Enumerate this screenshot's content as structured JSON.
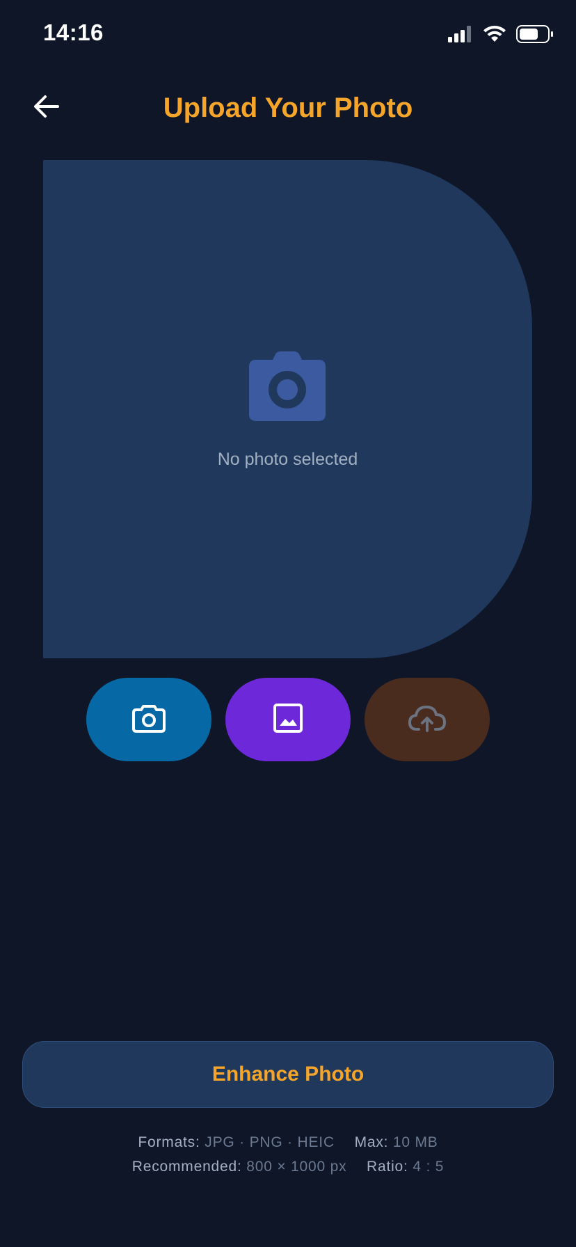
{
  "status_bar": {
    "time": "14:16",
    "icons": [
      "cellular-signal-icon",
      "wifi-icon",
      "battery-icon"
    ]
  },
  "header": {
    "title": "Upload Your Photo",
    "back_icon": "arrow-left-icon"
  },
  "photo_area": {
    "placeholder_icon": "camera-icon",
    "placeholder_text": "No photo selected"
  },
  "actions": [
    {
      "name": "take-photo",
      "icon": "camera-outline-icon",
      "color": "#0768a6"
    },
    {
      "name": "choose-from-gallery",
      "icon": "image-icon",
      "color": "#6d28d9"
    },
    {
      "name": "upload",
      "icon": "cloud-upload-icon",
      "color": "#4a2c1f",
      "disabled": true
    }
  ],
  "enhance_button": {
    "label": "Enhance Photo"
  },
  "info": {
    "formats_label": "Formats:",
    "formats_value": "JPG · PNG · HEIC",
    "max_label": "Max:",
    "max_value": "10 MB",
    "recommended_label": "Recommended:",
    "recommended_value": "800 × 1000 px",
    "ratio_label": "Ratio:",
    "ratio_value": "4 : 5"
  },
  "colors": {
    "background": "#0f1628",
    "surface": "#1f385c",
    "accent": "#f5a52a",
    "muted_text": "#a3b0c2"
  }
}
